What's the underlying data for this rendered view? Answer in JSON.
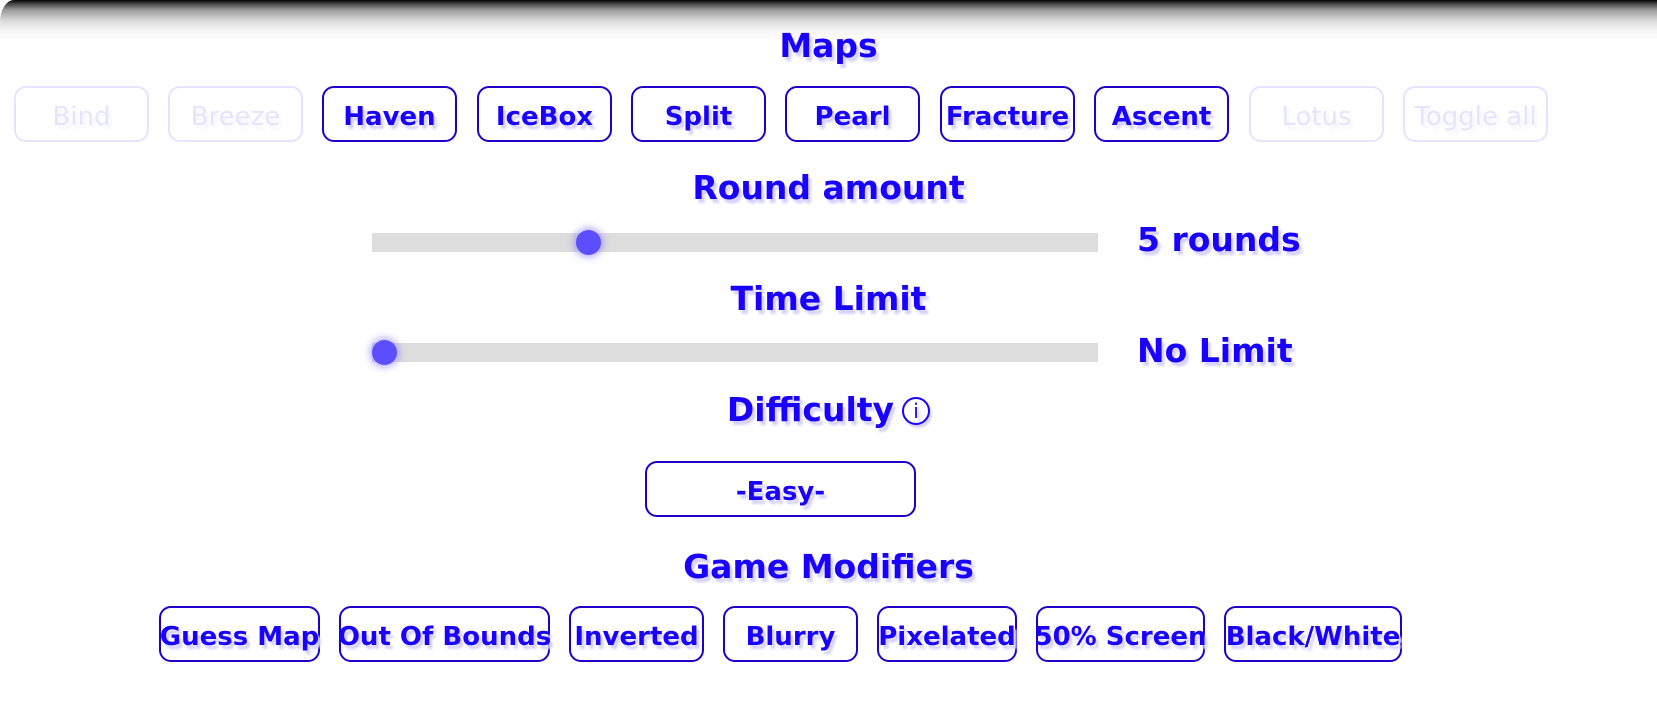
{
  "maps": {
    "title": "Maps",
    "buttons": [
      {
        "label": "Bind",
        "enabled": false
      },
      {
        "label": "Breeze",
        "enabled": false
      },
      {
        "label": "Haven",
        "enabled": true
      },
      {
        "label": "IceBox",
        "enabled": true
      },
      {
        "label": "Split",
        "enabled": true
      },
      {
        "label": "Pearl",
        "enabled": true
      },
      {
        "label": "Fracture",
        "enabled": true
      },
      {
        "label": "Ascent",
        "enabled": true
      },
      {
        "label": "Lotus",
        "enabled": false
      },
      {
        "label": "Toggle all",
        "enabled": false
      }
    ]
  },
  "round_amount": {
    "title": "Round amount",
    "value_label": "5 rounds",
    "slider_fraction": 0.29
  },
  "time_limit": {
    "title": "Time Limit",
    "value_label": "No Limit",
    "slider_fraction": 0.0
  },
  "difficulty": {
    "title": "Difficulty",
    "info_icon": "ⓘ",
    "selected": "-Easy-"
  },
  "game_modifiers": {
    "title": "Game Modifiers",
    "buttons": [
      {
        "label": "Guess Map"
      },
      {
        "label": "Out Of Bounds"
      },
      {
        "label": "Inverted"
      },
      {
        "label": "Blurry"
      },
      {
        "label": "Pixelated"
      },
      {
        "label": "50% Screen"
      },
      {
        "label": "Black/White"
      }
    ]
  },
  "colors": {
    "accent_text": "#1a00ff",
    "button_border": "#1e00c8",
    "disabled": "#e6e3ff",
    "slider_thumb": "#5c4dff",
    "slider_track": "#dddddd"
  }
}
